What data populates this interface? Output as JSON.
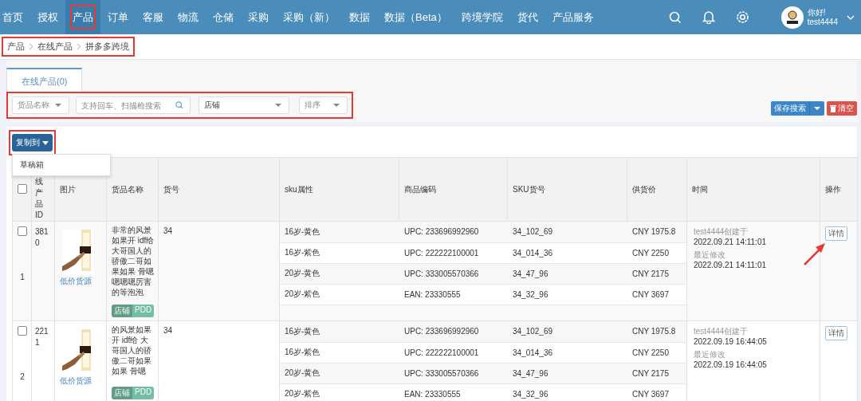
{
  "nav": {
    "items": [
      {
        "label": "首页",
        "selected": false,
        "highlighted": false
      },
      {
        "label": "授权",
        "selected": false,
        "highlighted": false
      },
      {
        "label": "产品",
        "selected": true,
        "highlighted": true
      },
      {
        "label": "订单",
        "selected": false,
        "highlighted": false
      },
      {
        "label": "客服",
        "selected": false,
        "highlighted": false
      },
      {
        "label": "物流",
        "selected": false,
        "highlighted": false
      },
      {
        "label": "仓储",
        "selected": false,
        "highlighted": false
      },
      {
        "label": "采购",
        "selected": false,
        "highlighted": false
      },
      {
        "label": "采购（新）",
        "selected": false,
        "highlighted": false
      },
      {
        "label": "数据",
        "selected": false,
        "highlighted": false
      },
      {
        "label": "数据（Beta）",
        "selected": false,
        "highlighted": false
      },
      {
        "label": "跨境学院",
        "selected": false,
        "highlighted": false
      },
      {
        "label": "货代",
        "selected": false,
        "highlighted": false
      },
      {
        "label": "产品服务",
        "selected": false,
        "highlighted": false
      }
    ],
    "user": {
      "greeting": "你好!",
      "name": "test4444"
    }
  },
  "breadcrumb": {
    "highlighted": true,
    "items": [
      "产品",
      "在线产品",
      "拼多多跨境"
    ]
  },
  "tabs": [
    {
      "label": "在线产品(0)",
      "selected": true
    }
  ],
  "filters": {
    "highlighted": true,
    "items": [
      {
        "kind": "select",
        "placeholder": "货品名称"
      },
      {
        "kind": "search",
        "placeholder": "支持回车、扫描枪搜索"
      },
      {
        "kind": "select",
        "value": "店铺"
      },
      {
        "kind": "select",
        "placeholder": "排序"
      }
    ]
  },
  "buttons": {
    "save_search": "保存搜索",
    "clear": "清空"
  },
  "copy_menu": {
    "label": "复制到",
    "open": true,
    "highlighted": true,
    "items": [
      "草稿箱"
    ]
  },
  "table": {
    "header_checked": false,
    "columns": [
      "线产品ID",
      "图片",
      "货品名称",
      "货号",
      "sku属性",
      "商品编码",
      "SKU货号",
      "供货价",
      "时间",
      "操作"
    ],
    "rows": [
      {
        "checked": false,
        "id": "3810",
        "number": "1",
        "link": "低价货源",
        "name": "非常的风景如果开 idf给大哥国人的骄傲二哥如果如果 骨嗯嗯嗯嗯厉害的等泡泡",
        "tag": {
          "label": "店铺",
          "value": "PDD"
        },
        "goods_no": "34",
        "skus": [
          {
            "attr": "16岁-黄色",
            "code": "UPC: 233696992960",
            "sku_no": "34_102_69",
            "price": "CNY 1975.8"
          },
          {
            "attr": "16岁-紫色",
            "code": "UPC: 222222100001",
            "sku_no": "34_014_36",
            "price": "CNY 2250"
          },
          {
            "attr": "20岁-黄色",
            "code": "UPC: 333005570366",
            "sku_no": "34_47_96",
            "price": "CNY 2175"
          },
          {
            "attr": "20岁-紫色",
            "code": "EAN: 23330555",
            "sku_no": "34_32_96",
            "price": "CNY 3697"
          }
        ],
        "time": {
          "created_label": "test4444创建于",
          "created": "2022.09.21 14:11:01",
          "modified_label": "最近修改",
          "modified": "2022.09.21 14:11:01"
        },
        "action": "详情",
        "pointed": true
      },
      {
        "checked": false,
        "id": "2211",
        "number": "2",
        "link": "低价货源",
        "name": "的风景如果开 idf给 大哥国人的骄傲二哥如果如果 骨嗯",
        "tag": {
          "label": "店铺",
          "value": "PDD"
        },
        "goods_no": "34",
        "skus": [
          {
            "attr": "16岁-黄色",
            "code": "UPC: 233696992960",
            "sku_no": "34_102_69",
            "price": "CNY 1975.8"
          },
          {
            "attr": "16岁-紫色",
            "code": "UPC: 222222100001",
            "sku_no": "34_014_36",
            "price": "CNY 2250"
          },
          {
            "attr": "20岁-黄色",
            "code": "UPC: 333005570366",
            "sku_no": "34_47_96",
            "price": "CNY 2175"
          },
          {
            "attr": "20岁-紫色",
            "code": "EAN: 23330555",
            "sku_no": "34_32_96",
            "price": "CNY 3697"
          }
        ],
        "time": {
          "created_label": "test4444创建于",
          "created": "2022.09.19 16:44:05",
          "modified_label": "最近修改",
          "modified": "2022.09.19 16:44:05"
        },
        "action": "详情",
        "pointed": false
      }
    ]
  }
}
